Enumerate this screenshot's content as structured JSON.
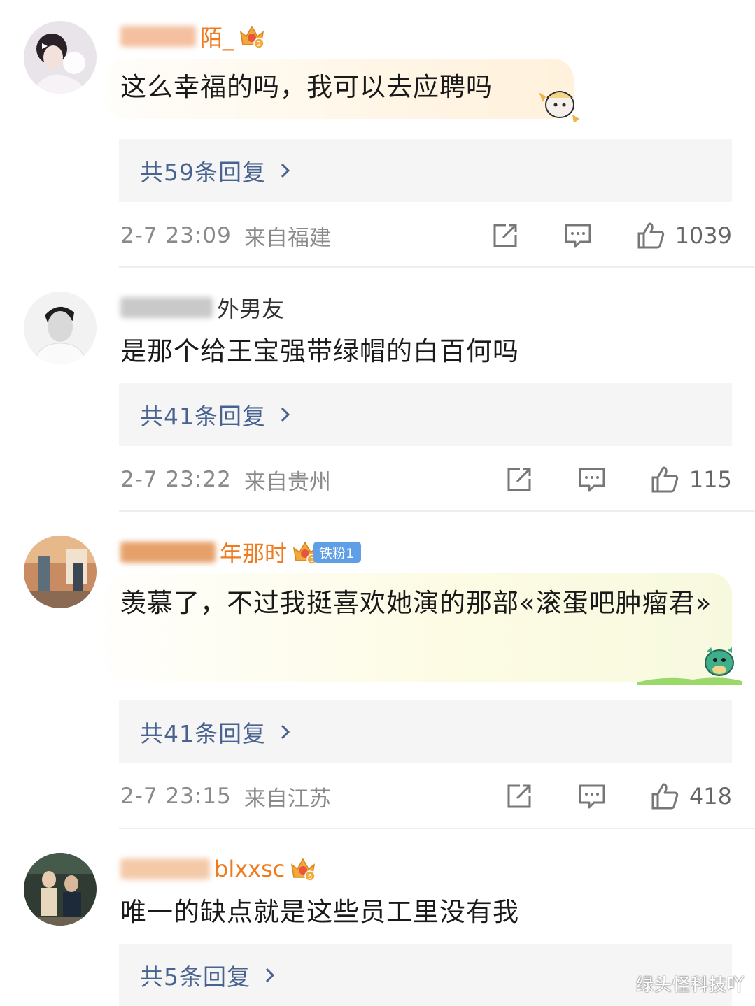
{
  "comments": [
    {
      "name_visible": "陌_",
      "text": "这么幸福的吗，我可以去应聘吗",
      "reply_label": "共59条回复",
      "time": "2-7 23:09",
      "location": "来自福建",
      "likes": "1039",
      "badge_icon": "crown-level-2-icon"
    },
    {
      "name_visible": "外男友",
      "text": "是那个给王宝强带绿帽的白百何吗",
      "reply_label": "共41条回复",
      "time": "2-7 23:22",
      "location": "来自贵州",
      "likes": "115"
    },
    {
      "name_visible": "年那时",
      "fan_badge": "铁粉1",
      "text": "羡慕了，不过我挺喜欢她演的那部«滚蛋吧肿瘤君»",
      "reply_label": "共41条回复",
      "time": "2-7 23:15",
      "location": "来自江苏",
      "likes": "418",
      "badge_icon": "crown-level-5-icon"
    },
    {
      "name_visible": "blxxsc",
      "text": "唯一的缺点就是这些员工里没有我",
      "reply_label": "共5条回复",
      "badge_icon": "crown-level-6-icon"
    }
  ],
  "watermark": "绿头怪科技吖",
  "colors": {
    "name_orange": "#f07a1c",
    "reply_link": "#48638f",
    "meta_gray": "#8a8a8a",
    "reply_bg": "#f5f5f5"
  }
}
